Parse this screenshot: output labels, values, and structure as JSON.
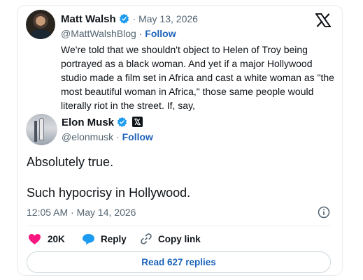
{
  "quoted": {
    "name": "Matt Walsh",
    "date": "May 13, 2026",
    "handle": "@MattWalshBlog",
    "follow": "Follow",
    "text": "We're told that we shouldn't object to Helen of Troy being portrayed as a black woman. And yet if a major Hollywood studio made a film set in Africa and cast a white woman as \"the most beautiful woman in Africa,\" those same people would literally riot in the street. If, say,"
  },
  "post": {
    "name": "Elon Musk",
    "handle": "@elonmusk",
    "follow": "Follow",
    "line1": "Absolutely true.",
    "line2": "Such hypocrisy in Hollywood.",
    "timestamp": "12:05 AM · May 14, 2026"
  },
  "actions": {
    "likes": "20K",
    "reply": "Reply",
    "copy_link": "Copy link",
    "read_replies": "Read 627 replies"
  },
  "colors": {
    "verified": "#1d9bf0",
    "like": "#f91880",
    "reply_icon": "#1d9bf0",
    "link": "#1d63b8"
  },
  "icons": [
    "x-logo-icon",
    "verified-badge-icon",
    "info-icon",
    "heart-icon",
    "reply-bubble-icon",
    "link-icon"
  ]
}
